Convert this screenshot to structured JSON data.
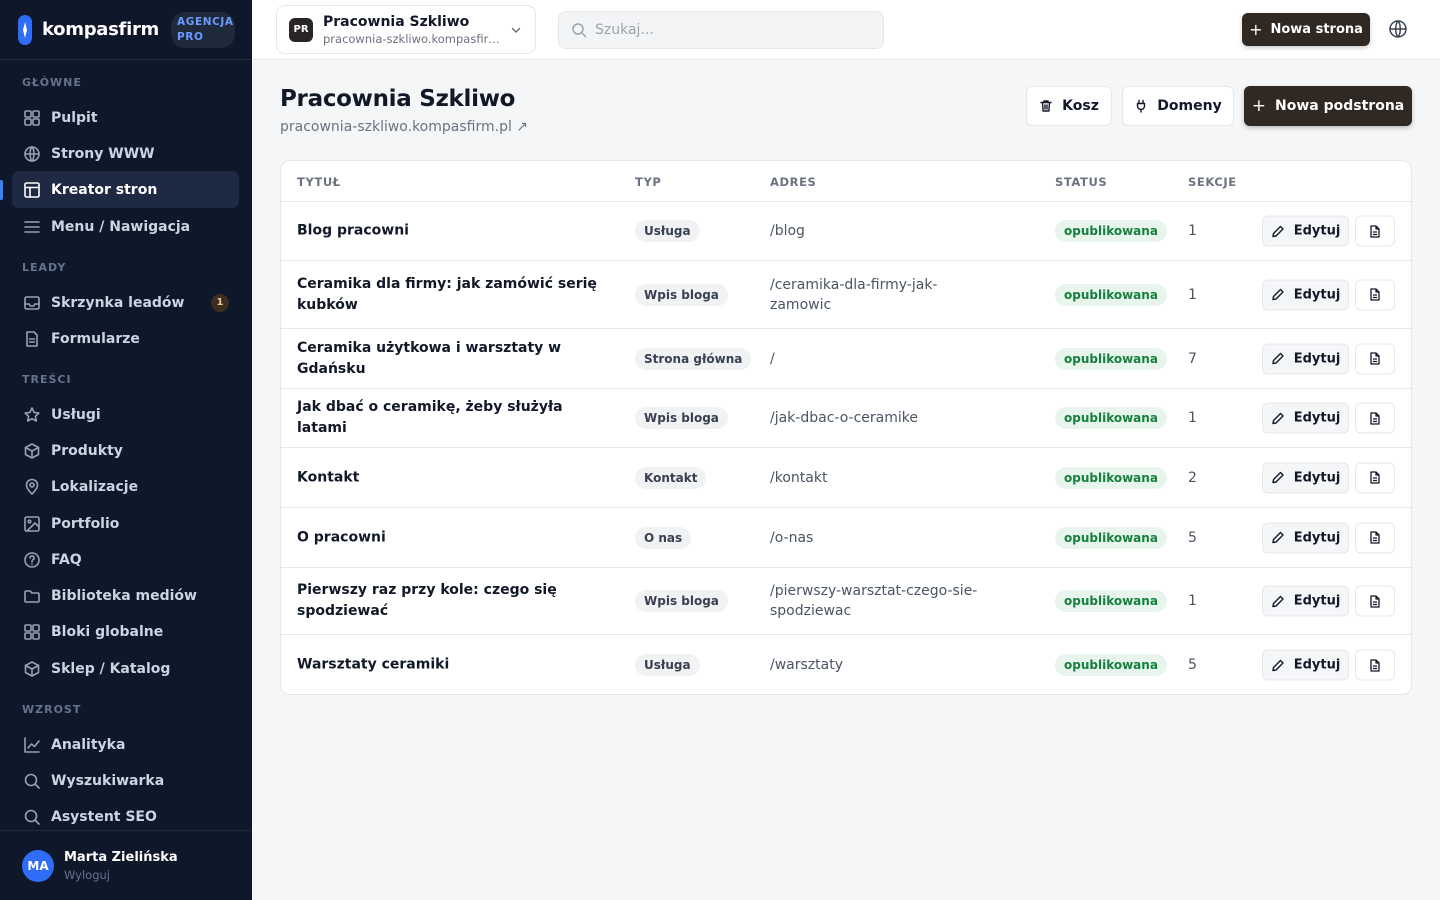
{
  "brand": {
    "name": "kompasfirm",
    "badge": "AGENCJA PRO"
  },
  "sidebar": {
    "sections": [
      "GŁÓWNE",
      "LEADY",
      "TREŚCI",
      "WZROST"
    ],
    "items": [
      {
        "label": "Pulpit",
        "icon": "grid-icon"
      },
      {
        "label": "Strony WWW",
        "icon": "globe-icon"
      },
      {
        "label": "Kreator stron",
        "icon": "layout-icon",
        "active": true
      },
      {
        "label": "Menu / Nawigacja",
        "icon": "menu-icon"
      },
      {
        "label": "Skrzynka leadów",
        "icon": "inbox-icon",
        "badge": "1"
      },
      {
        "label": "Formularze",
        "icon": "form-icon"
      },
      {
        "label": "Usługi",
        "icon": "star-icon"
      },
      {
        "label": "Produkty",
        "icon": "box-icon"
      },
      {
        "label": "Lokalizacje",
        "icon": "map-pin-icon"
      },
      {
        "label": "Portfolio",
        "icon": "image-icon"
      },
      {
        "label": "FAQ",
        "icon": "help-icon"
      },
      {
        "label": "Biblioteka mediów",
        "icon": "folder-icon"
      },
      {
        "label": "Bloki globalne",
        "icon": "grid-icon"
      },
      {
        "label": "Sklep / Katalog",
        "icon": "box-icon"
      },
      {
        "label": "Analityka",
        "icon": "chart-icon"
      },
      {
        "label": "Wyszukiwarka",
        "icon": "search-icon"
      },
      {
        "label": "Asystent SEO",
        "icon": "search-icon"
      }
    ],
    "user": {
      "initials": "MA",
      "name": "Marta Zielińska",
      "logout": "Wyloguj"
    }
  },
  "topbar": {
    "site": {
      "initials": "PR",
      "name": "Pracownia Szkliwo",
      "url": "pracownia-szkliwo.kompasfirm.pl"
    },
    "search_placeholder": "Szukaj...",
    "new_page_label": "Nowa strona"
  },
  "main": {
    "title": "Pracownia Szkliwo",
    "url": "pracownia-szkliwo.kompasfirm.pl ↗",
    "buttons": {
      "trash": "Kosz",
      "domains": "Domeny",
      "new_subpage": "Nowa podstrona"
    },
    "columns": [
      "TYTUŁ",
      "TYP",
      "ADRES",
      "STATUS",
      "SEKCJE"
    ],
    "edit_label": "Edytuj",
    "rows": [
      {
        "title": "Blog pracowni",
        "type": "Usługa",
        "address": "/blog",
        "status": "opublikowana",
        "sections": "1"
      },
      {
        "title": "Ceramika dla firmy: jak zamówić serię kubków",
        "type": "Wpis bloga",
        "address": "/ceramika-dla-firmy-jak-zamowic",
        "status": "opublikowana",
        "sections": "1"
      },
      {
        "title": "Ceramika użytkowa i warsztaty w Gdańsku",
        "type": "Strona główna",
        "address": "/",
        "status": "opublikowana",
        "sections": "7"
      },
      {
        "title": "Jak dbać o ceramikę, żeby służyła latami",
        "type": "Wpis bloga",
        "address": "/jak-dbac-o-ceramike",
        "status": "opublikowana",
        "sections": "1"
      },
      {
        "title": "Kontakt",
        "type": "Kontakt",
        "address": "/kontakt",
        "status": "opublikowana",
        "sections": "2"
      },
      {
        "title": "O pracowni",
        "type": "O nas",
        "address": "/o-nas",
        "status": "opublikowana",
        "sections": "5"
      },
      {
        "title": "Pierwszy raz przy kole: czego się spodziewać",
        "type": "Wpis bloga",
        "address": "/pierwszy-warsztat-czego-sie-spodziewac",
        "status": "opublikowana",
        "sections": "1"
      },
      {
        "title": "Warsztaty ceramiki",
        "type": "Usługa",
        "address": "/warsztaty",
        "status": "opublikowana",
        "sections": "5"
      }
    ]
  }
}
